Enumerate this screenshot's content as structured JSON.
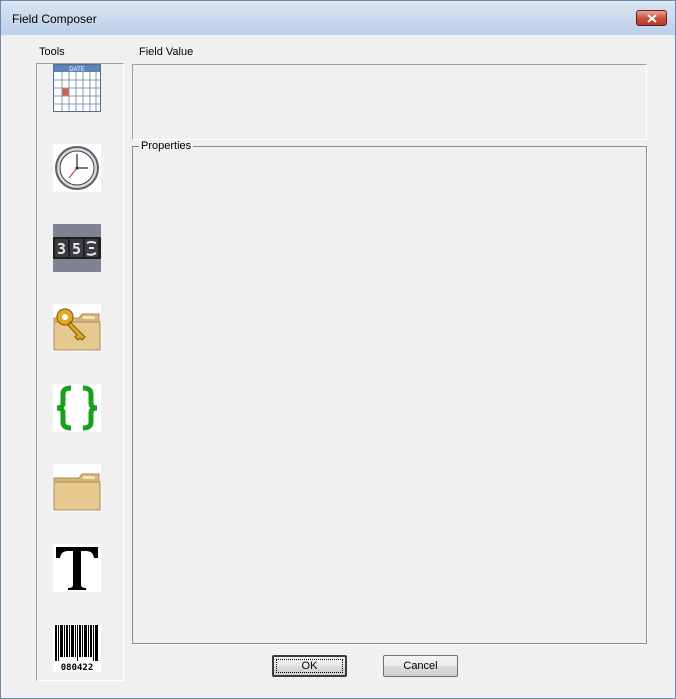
{
  "window": {
    "title": "Field Composer"
  },
  "labels": {
    "tools": "Tools",
    "field_value": "Field Value",
    "properties": "Properties"
  },
  "field_value": {
    "value": ""
  },
  "tools": [
    {
      "icon": "calendar-date-icon",
      "caption": "DATE"
    },
    {
      "icon": "clock-icon"
    },
    {
      "icon": "counter-icon",
      "caption": "35"
    },
    {
      "icon": "key-folder-icon"
    },
    {
      "icon": "curly-braces-icon",
      "caption": "{}"
    },
    {
      "icon": "folder-icon"
    },
    {
      "icon": "text-icon",
      "caption": "T"
    },
    {
      "icon": "barcode-icon",
      "caption": "080422"
    }
  ],
  "buttons": {
    "ok": "OK",
    "cancel": "Cancel"
  },
  "colors": {
    "titlebar": "#c7d7ec",
    "close": "#c7503b",
    "braces": "#17a317",
    "dialog_bg": "#f0f0f0"
  }
}
